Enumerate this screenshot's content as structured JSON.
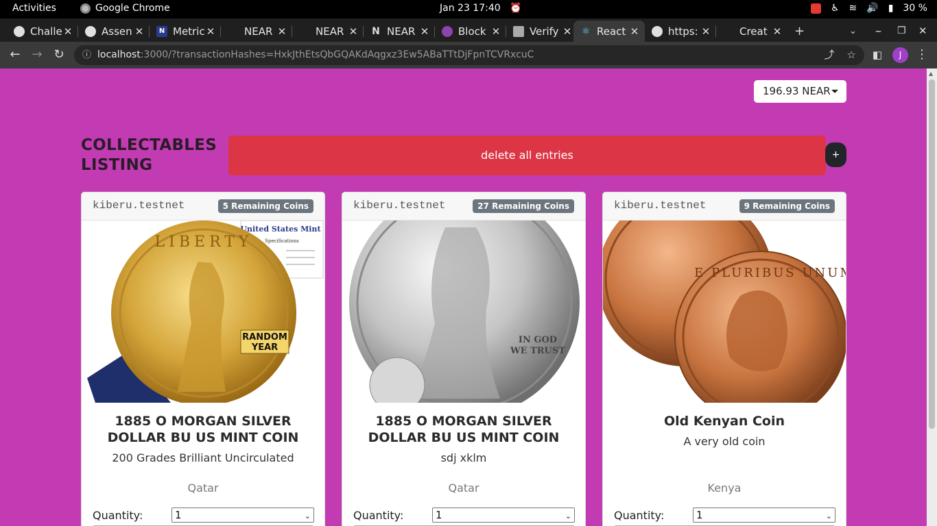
{
  "system_bar": {
    "activities": "Activities",
    "app_name": "Google Chrome",
    "clock": "Jan 23  17:40",
    "battery": "30 %"
  },
  "tabs": [
    {
      "label": "Challe"
    },
    {
      "label": "Assen"
    },
    {
      "label": "Metric"
    },
    {
      "label": "NEAR"
    },
    {
      "label": "NEAR"
    },
    {
      "label": "NEAR"
    },
    {
      "label": "Block"
    },
    {
      "label": "Verify"
    },
    {
      "label": "React"
    },
    {
      "label": "https:"
    },
    {
      "label": "Creat"
    }
  ],
  "address": {
    "host": "localhost",
    "rest": ":3000/?transactionHashes=HxkJthEtsQbGQAKdAqgxz3Ew5ABaTTtDjFpnTCVRxcuC"
  },
  "profile_initial": "J",
  "balance": "196.93 NEAR",
  "heading": "COLLECTABLES LISTING",
  "delete_all_label": "delete all entries",
  "add_label": "+",
  "quantity_label": "Quantity:",
  "cards": [
    {
      "owner": "kiberu.testnet",
      "badge": "5 Remaining Coins",
      "name": "1885 O MORGAN SILVER DOLLAR BU US MINT COIN",
      "description": "200 Grades Brilliant Uncirculated",
      "location": "Qatar",
      "quantity": "1",
      "image": "gold-eagle-coin",
      "cert_title": "United States Mint",
      "cert_sub": "Specifications",
      "stamp": "RANDOM YEAR",
      "coin_text": "LIBERTY"
    },
    {
      "owner": "kiberu.testnet",
      "badge": "27 Remaining Coins",
      "name": "1885 O MORGAN SILVER DOLLAR BU US MINT COIN",
      "description": "sdj xklm",
      "location": "Qatar",
      "quantity": "1",
      "image": "silver-eagle-coin",
      "coin_text": "IN GOD WE TRUST"
    },
    {
      "owner": "kiberu.testnet",
      "badge": "9 Remaining Coins",
      "name": "Old Kenyan Coin",
      "description": "A very old coin",
      "location": "Kenya",
      "quantity": "1",
      "image": "copper-coins",
      "coin_text": "E PLURIBUS UNUM"
    }
  ]
}
